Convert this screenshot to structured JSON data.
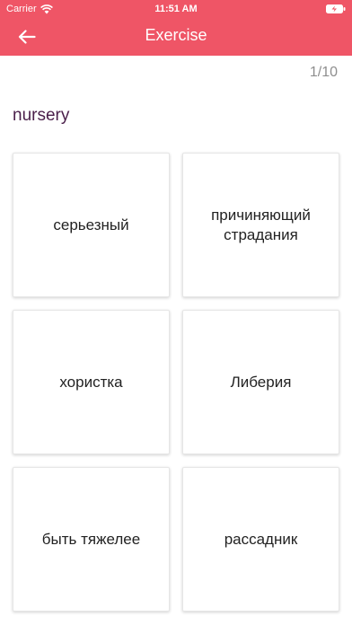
{
  "status_bar": {
    "carrier": "Carrier",
    "time": "11:51 AM"
  },
  "nav": {
    "title": "Exercise",
    "back_icon": "arrow-left-icon",
    "color": "#ef5566"
  },
  "progress": {
    "text": "1/10"
  },
  "question": {
    "word": "nursery"
  },
  "options": [
    {
      "label": "серьезный"
    },
    {
      "label": "причиняющий страдания"
    },
    {
      "label": "хористка"
    },
    {
      "label": "Либерия"
    },
    {
      "label": "быть тяжелее"
    },
    {
      "label": "рассадник"
    }
  ]
}
